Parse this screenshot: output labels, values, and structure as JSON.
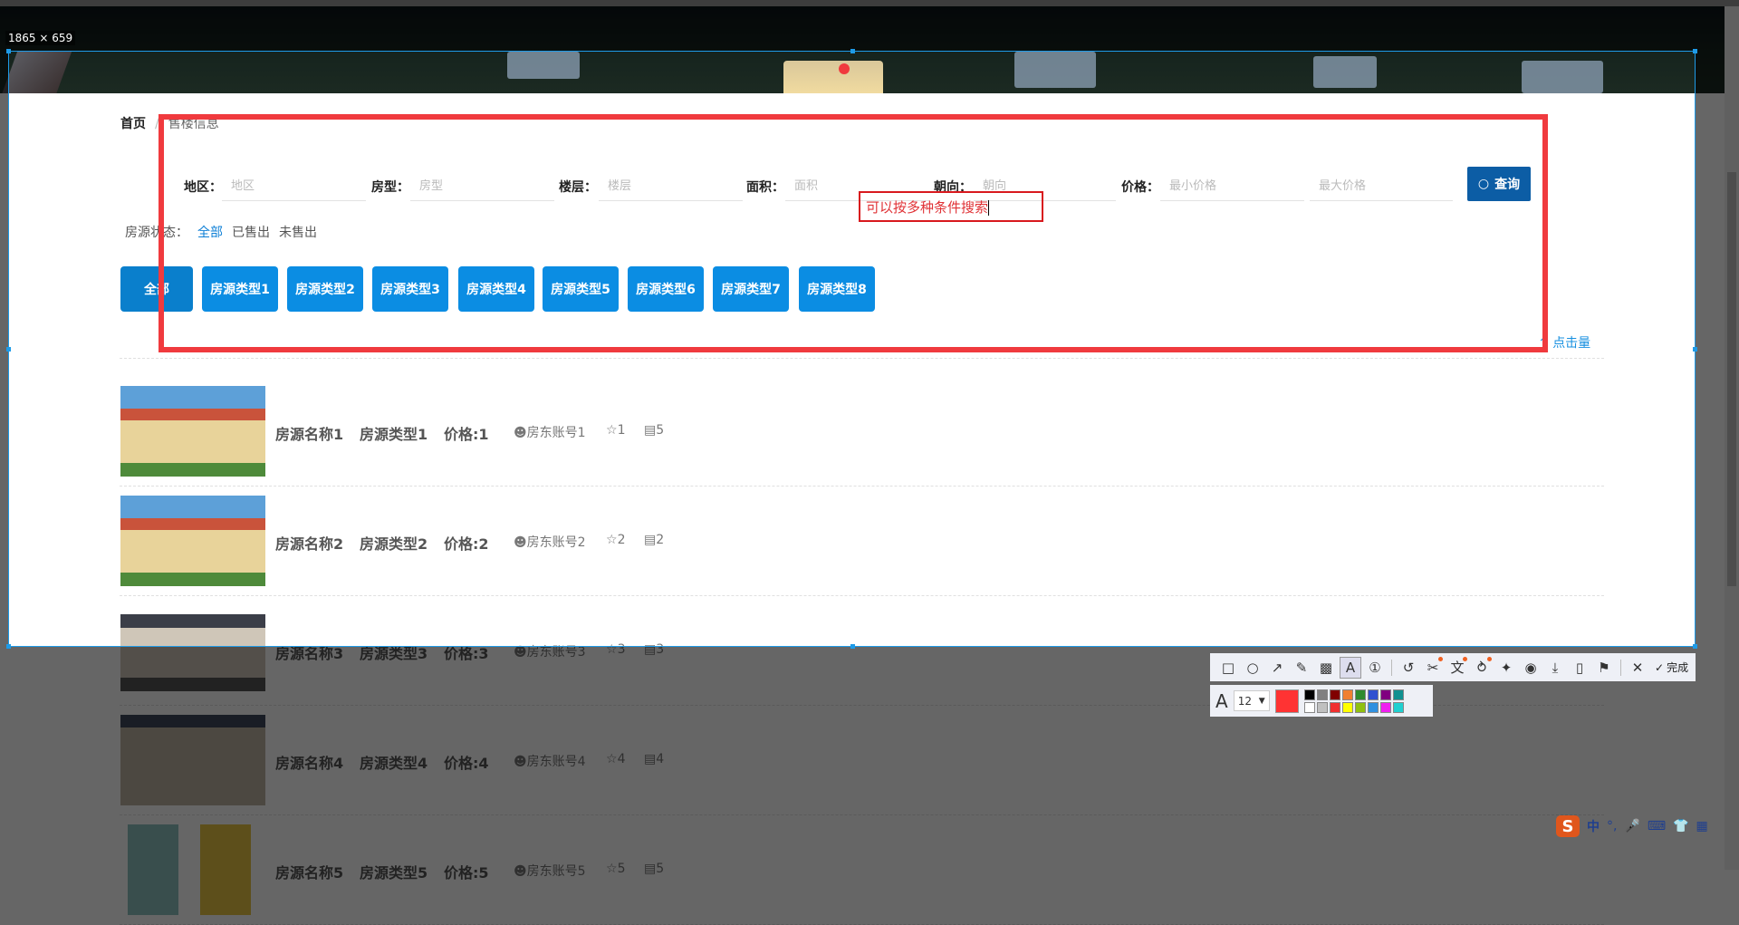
{
  "screenshot_tool": {
    "size_label": "1865 × 659",
    "annotation_text": "可以按多种条件搜索",
    "font_size": "12",
    "done_label": "完成",
    "current_color": "#ff3333",
    "palette": [
      "#000000",
      "#808080",
      "#800000",
      "#f08030",
      "#2e8b2e",
      "#3050d0",
      "#800080",
      "#109090",
      "#ffffff",
      "#c0c0c0",
      "#f03030",
      "#ffff00",
      "#90c010",
      "#3090e0",
      "#f020f0",
      "#20d0d0"
    ],
    "tools": [
      "rectangle",
      "ellipse",
      "arrow",
      "pencil",
      "mosaic",
      "text",
      "number",
      "undo",
      "cut",
      "translate",
      "ocr",
      "pin",
      "record",
      "save",
      "long-screenshot",
      "bookmark",
      "close"
    ]
  },
  "breadcrumb": {
    "home": "首页",
    "separator": "/",
    "current": "售楼信息"
  },
  "search": {
    "region": {
      "label": "地区：",
      "placeholder": "地区"
    },
    "house_type": {
      "label": "房型：",
      "placeholder": "房型"
    },
    "floor": {
      "label": "楼层：",
      "placeholder": "楼层"
    },
    "area": {
      "label": "面积：",
      "placeholder": "面积"
    },
    "orientation": {
      "label": "朝向：",
      "placeholder": "朝向"
    },
    "price": {
      "label": "价格：",
      "min_placeholder": "最小价格",
      "max_placeholder": "最大价格"
    },
    "query_label": "查询"
  },
  "status_filter": {
    "label": "房源状态：",
    "options": [
      "全部",
      "已售出",
      "未售出"
    ],
    "active": "全部"
  },
  "type_buttons": [
    "全部",
    "房源类型1",
    "房源类型2",
    "房源类型3",
    "房源类型4",
    "房源类型5",
    "房源类型6",
    "房源类型7",
    "房源类型8"
  ],
  "sort_label": "点击量",
  "listings": [
    {
      "name": "房源名称1",
      "type": "房源类型1",
      "price": "价格:1",
      "owner": "房东账号1",
      "stars": "1",
      "comments": "5"
    },
    {
      "name": "房源名称2",
      "type": "房源类型2",
      "price": "价格:2",
      "owner": "房东账号2",
      "stars": "2",
      "comments": "2"
    },
    {
      "name": "房源名称3",
      "type": "房源类型3",
      "price": "价格:3",
      "owner": "房东账号3",
      "stars": "3",
      "comments": "3"
    },
    {
      "name": "房源名称4",
      "type": "房源类型4",
      "price": "价格:4",
      "owner": "房东账号4",
      "stars": "4",
      "comments": "4"
    },
    {
      "name": "房源名称5",
      "type": "房源类型5",
      "price": "价格:5",
      "owner": "房东账号5",
      "stars": "5",
      "comments": "5"
    }
  ],
  "ime": {
    "mode": "中"
  }
}
